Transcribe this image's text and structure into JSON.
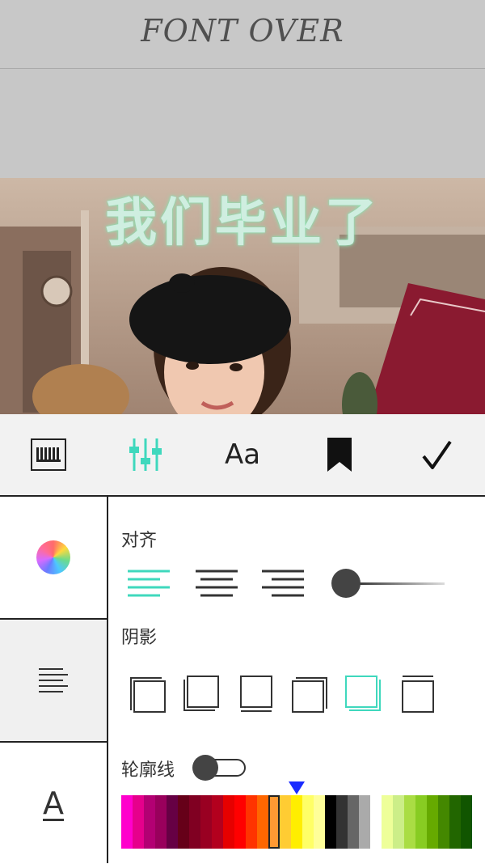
{
  "app": {
    "title": "FONT OVER"
  },
  "canvas": {
    "overlay_text": "我们毕业了"
  },
  "toolbar": {
    "font_label": "Aa",
    "tools": [
      {
        "name": "keyboard-icon"
      },
      {
        "name": "adjust-sliders-icon",
        "active": true
      },
      {
        "name": "font-aa-icon"
      },
      {
        "name": "bookmark-icon"
      },
      {
        "name": "checkmark-icon"
      }
    ]
  },
  "side_panel": {
    "font_style_label": "A"
  },
  "alignment": {
    "label": "对齐",
    "options": [
      "left",
      "center",
      "right"
    ],
    "selected": "left",
    "spacing_slider_value": 0.0
  },
  "shadow": {
    "label": "阴影",
    "options": [
      "top-left",
      "bottom-left",
      "bottom",
      "top-right",
      "bottom-right",
      "top"
    ],
    "selected": "bottom-right"
  },
  "outline": {
    "label": "轮廓线",
    "enabled": false
  },
  "palette": {
    "accent": "#3fd8bd",
    "selected_index": 13,
    "colors": [
      "#ff00cc",
      "#e6008c",
      "#b30073",
      "#99005c",
      "#660044",
      "#660019",
      "#800022",
      "#990022",
      "#b3001e",
      "#e60000",
      "#ff0000",
      "#ff3300",
      "#ff6600",
      "#ff9933",
      "#ffcc33",
      "#ffee00",
      "#ffff66",
      "#ffff99",
      "#000000",
      "#333333",
      "#666666",
      "#aaaaaa",
      "#ffffff",
      "#eeff99",
      "#ccee88",
      "#aadd44",
      "#88cc22",
      "#66aa00",
      "#448800",
      "#226600",
      "#115500"
    ]
  }
}
